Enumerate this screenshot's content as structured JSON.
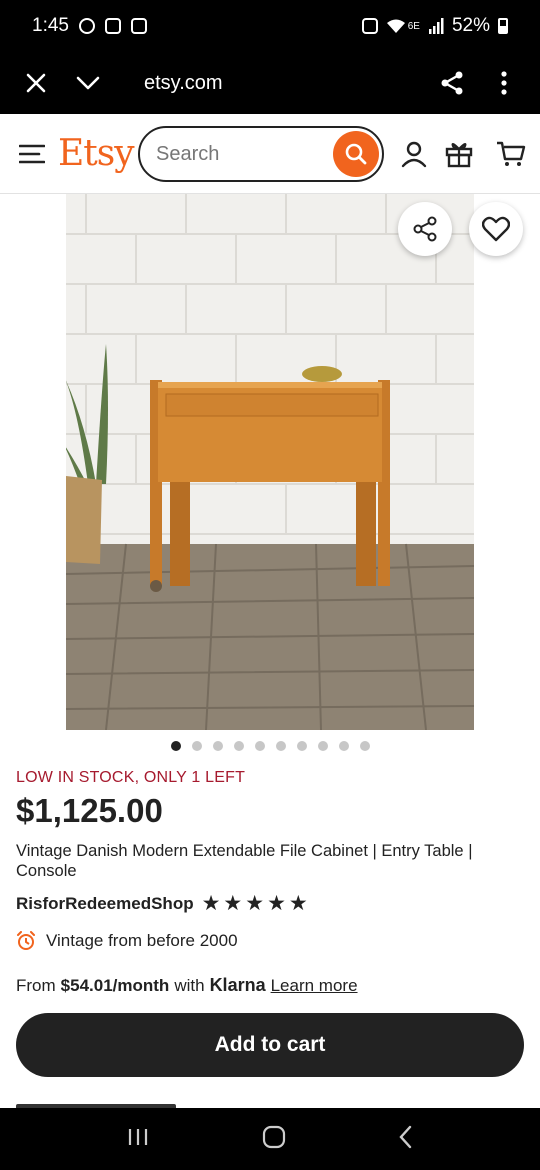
{
  "status_bar": {
    "time": "1:45",
    "network": "6E",
    "battery": "52%"
  },
  "browser": {
    "url": "etsy.com"
  },
  "header": {
    "logo": "Etsy",
    "search_placeholder": "Search"
  },
  "product": {
    "image_count": 10,
    "active_image": 1,
    "stock_notice": "LOW IN STOCK, ONLY 1 LEFT",
    "price": "$1,125.00",
    "title": "Vintage Danish Modern Extendable File Cabinet | Entry Table | Console",
    "shop_name": "RisforRedeemedShop",
    "rating_stars": 5,
    "vintage_note": "Vintage from before 2000",
    "klarna": {
      "prefix": "From",
      "amount": "$54.01/month",
      "with": "with",
      "brand": "Klarna",
      "learn_more": "Learn more"
    },
    "add_to_cart": "Add to cart"
  },
  "colors": {
    "accent": "#f1641e",
    "stock_red": "#a61a2e",
    "dark": "#222222"
  }
}
